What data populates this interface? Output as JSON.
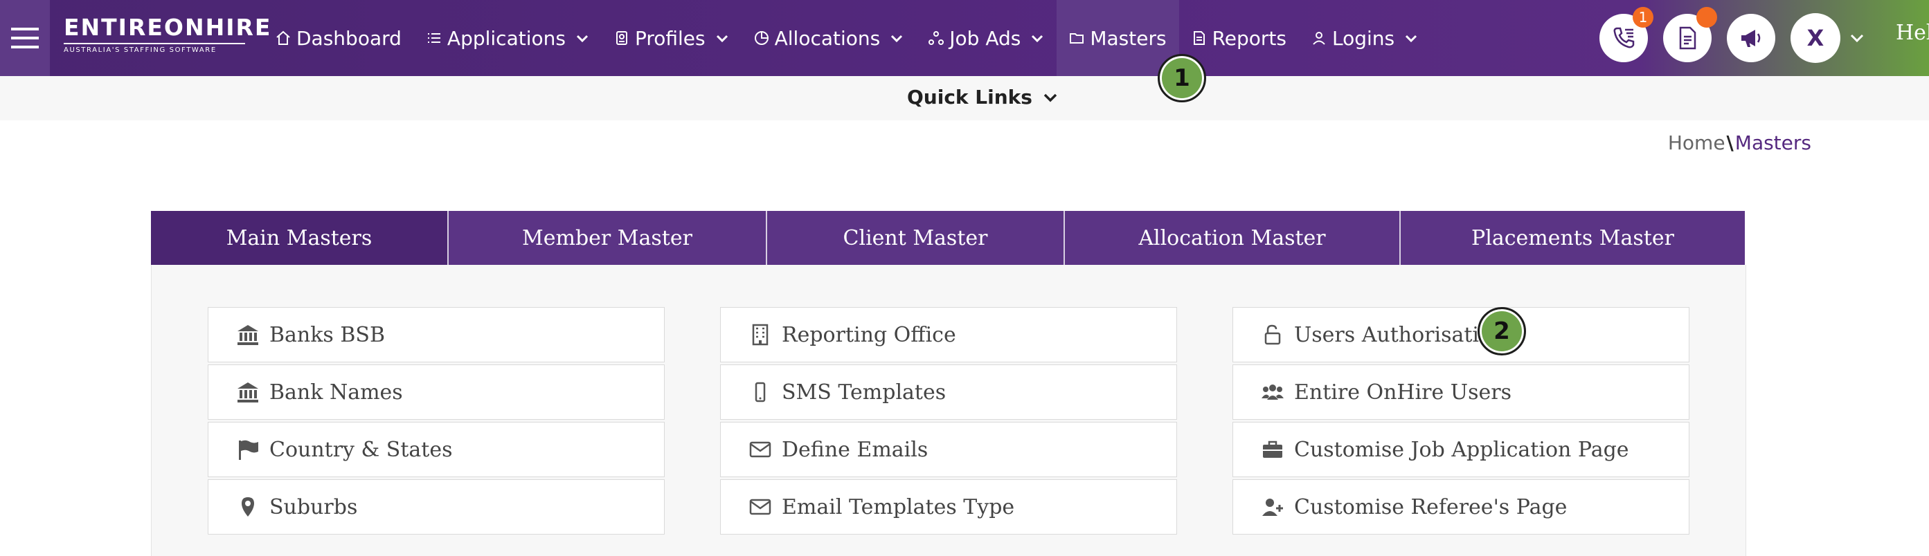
{
  "header": {
    "logo_main": "ENTIREONHIRE",
    "logo_sub": "AUSTRALIA'S STAFFING SOFTWARE",
    "nav": [
      {
        "label": "Dashboard",
        "icon": "home-icon"
      },
      {
        "label": "Applications",
        "icon": "list-icon"
      },
      {
        "label": "Profiles",
        "icon": "id-badge-icon"
      },
      {
        "label": "Allocations",
        "icon": "pie-chart-icon"
      },
      {
        "label": "Job Ads",
        "icon": "network-icon"
      },
      {
        "label": "Masters",
        "icon": "folder-icon"
      },
      {
        "label": "Reports",
        "icon": "document-icon"
      },
      {
        "label": "Logins",
        "icon": "user-icon"
      }
    ],
    "call_badge": "1",
    "avatar_letter": "X",
    "help_text": "Help"
  },
  "quick_links": {
    "label": "Quick Links"
  },
  "steps": {
    "one": "1",
    "two": "2"
  },
  "breadcrumb": {
    "home": "Home",
    "separator": "\\",
    "current": "Masters"
  },
  "tabs": [
    {
      "label": "Main Masters"
    },
    {
      "label": "Member Master"
    },
    {
      "label": "Client Master"
    },
    {
      "label": "Allocation Master"
    },
    {
      "label": "Placements Master"
    }
  ],
  "columns": {
    "col1": [
      {
        "label": "Banks BSB",
        "icon": "bank-icon"
      },
      {
        "label": "Bank Names",
        "icon": "bank-icon"
      },
      {
        "label": "Country & States",
        "icon": "flag-icon"
      },
      {
        "label": "Suburbs",
        "icon": "map-marker-icon"
      }
    ],
    "col2": [
      {
        "label": "Reporting Office",
        "icon": "building-icon"
      },
      {
        "label": "SMS Templates",
        "icon": "mobile-icon"
      },
      {
        "label": "Define Emails",
        "icon": "envelope-icon"
      },
      {
        "label": "Email Templates Type",
        "icon": "envelope-icon"
      }
    ],
    "col3": [
      {
        "label": "Users Authorisation",
        "icon": "lock-open-icon"
      },
      {
        "label": "Entire OnHire Users",
        "icon": "users-icon"
      },
      {
        "label": "Customise Job Application Page",
        "icon": "briefcase-icon"
      },
      {
        "label": "Customise Referee's Page",
        "icon": "user-plus-icon"
      }
    ]
  },
  "colors": {
    "brand_purple": "#4a2571",
    "tab_purple": "#5b3485",
    "badge_orange": "#f36b21",
    "step_green": "#6ea34a"
  }
}
